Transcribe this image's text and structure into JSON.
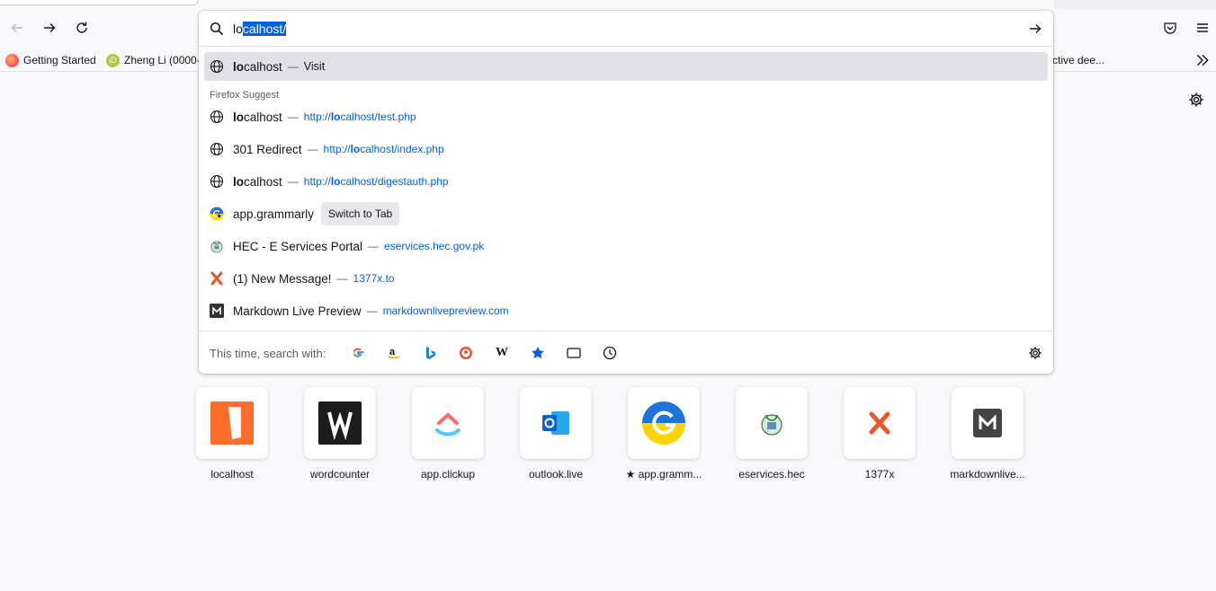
{
  "toolbar": {
    "back_icon": "arrow-left-icon",
    "forward_icon": "arrow-right-icon",
    "reload_icon": "reload-icon",
    "pocket_icon": "pocket-icon",
    "menu_icon": "hamburger-menu-icon"
  },
  "bookmarks": [
    {
      "label": "Getting Started",
      "icon": "firefox-icon"
    },
    {
      "label": "Zheng Li (0000-",
      "icon": "orcid-icon"
    },
    {
      "label": "ctive dee...",
      "icon": ""
    }
  ],
  "urlbar": {
    "typed": "lo",
    "autofill_selected": "calhost/",
    "heuristic": {
      "title_bold": "lo",
      "title_rest": "calhost",
      "sep": "—",
      "action": "Visit"
    },
    "group_label": "Firefox Suggest",
    "results": [
      {
        "title_bold": "lo",
        "title_rest": "calhost",
        "sep": "—",
        "url_pre": "http://",
        "url_bold": "lo",
        "url_post": "calhost/test.php",
        "icon": "globe-icon"
      },
      {
        "title_bold": "",
        "title_rest": "301 Redirect",
        "sep": "—",
        "url_pre": "http://",
        "url_bold": "lo",
        "url_post": "calhost/index.php",
        "icon": "globe-icon"
      },
      {
        "title_bold": "lo",
        "title_rest": "calhost",
        "sep": "—",
        "url_pre": "http://",
        "url_bold": "lo",
        "url_post": "calhost/digestauth.php",
        "icon": "globe-icon"
      }
    ],
    "grammarly": {
      "title": "app.grammarly",
      "button": "Switch to Tab"
    },
    "other_results": [
      {
        "title": "HEC - E Services Portal",
        "sep": "—",
        "url": "eservices.hec.gov.pk",
        "icon": "hec-icon"
      },
      {
        "title": "(1) New Message!",
        "sep": "—",
        "url": "1377x.to",
        "icon": "1377x-icon"
      },
      {
        "title": "Markdown Live Preview",
        "sep": "—",
        "url": "markdownlivepreview.com",
        "icon": "markdown-icon"
      }
    ],
    "search_with_label": "This time, search with:"
  },
  "tiles": [
    {
      "label": "localhost"
    },
    {
      "label": "wordcounter"
    },
    {
      "label": "app.clickup"
    },
    {
      "label": "outlook.live"
    },
    {
      "label": "app.gramm..."
    },
    {
      "label": "eservices.hec"
    },
    {
      "label": "1377x"
    },
    {
      "label": "markdownlive..."
    }
  ]
}
